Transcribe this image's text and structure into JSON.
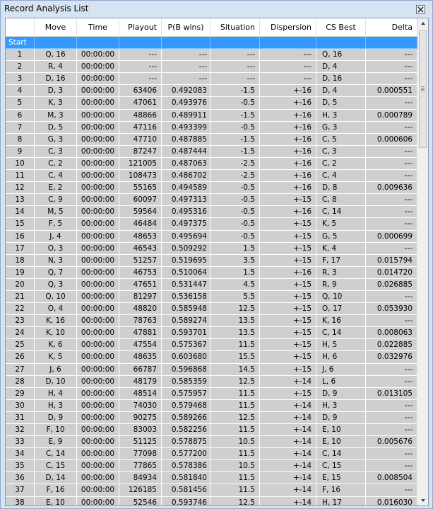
{
  "window": {
    "title": "Record Analysis List"
  },
  "columns": [
    "",
    "Move",
    "Time",
    "Playout",
    "P(B wins)",
    "Situation",
    "Dispersion",
    "CS Best",
    "Delta"
  ],
  "start_row": {
    "label": "Start"
  },
  "rows": [
    [
      "1",
      "Q, 16",
      "00:00:00",
      "---",
      "---",
      "---",
      "---",
      "Q, 16",
      "---"
    ],
    [
      "2",
      "R, 4",
      "00:00:00",
      "---",
      "---",
      "---",
      "---",
      "D, 4",
      "---"
    ],
    [
      "3",
      "D, 16",
      "00:00:00",
      "---",
      "---",
      "---",
      "---",
      "D, 16",
      "---"
    ],
    [
      "4",
      "D, 3",
      "00:00:00",
      "63406",
      "0.492083",
      "-1.5",
      "+-16",
      "D, 4",
      "0.000551"
    ],
    [
      "5",
      "K, 3",
      "00:00:00",
      "47061",
      "0.493976",
      "-0.5",
      "+-16",
      "D, 5",
      "---"
    ],
    [
      "6",
      "M, 3",
      "00:00:00",
      "48866",
      "0.489911",
      "-1.5",
      "+-16",
      "H, 3",
      "0.000789"
    ],
    [
      "7",
      "D, 5",
      "00:00:00",
      "47116",
      "0.493399",
      "-0.5",
      "+-16",
      "G, 3",
      "---"
    ],
    [
      "8",
      "G, 3",
      "00:00:00",
      "47710",
      "0.487885",
      "-1.5",
      "+-16",
      "C, 5",
      "0.000606"
    ],
    [
      "9",
      "C, 3",
      "00:00:00",
      "87247",
      "0.487444",
      "-1.5",
      "+-16",
      "C, 3",
      "---"
    ],
    [
      "10",
      "C, 2",
      "00:00:00",
      "121005",
      "0.487063",
      "-2.5",
      "+-16",
      "C, 2",
      "---"
    ],
    [
      "11",
      "C, 4",
      "00:00:00",
      "108473",
      "0.486702",
      "-2.5",
      "+-16",
      "C, 4",
      "---"
    ],
    [
      "12",
      "E, 2",
      "00:00:00",
      "55165",
      "0.494589",
      "-0.5",
      "+-16",
      "D, 8",
      "0.009636"
    ],
    [
      "13",
      "C, 9",
      "00:00:00",
      "60097",
      "0.497313",
      "-0.5",
      "+-15",
      "C, 8",
      "---"
    ],
    [
      "14",
      "M, 5",
      "00:00:00",
      "59564",
      "0.495316",
      "-0.5",
      "+-16",
      "C, 14",
      "---"
    ],
    [
      "15",
      "F, 5",
      "00:00:00",
      "46484",
      "0.497375",
      "-0.5",
      "+-15",
      "K, 5",
      "---"
    ],
    [
      "16",
      "J, 4",
      "00:00:00",
      "48653",
      "0.495694",
      "-0.5",
      "+-15",
      "G, 5",
      "0.000699"
    ],
    [
      "17",
      "O, 3",
      "00:00:00",
      "46543",
      "0.509292",
      "1.5",
      "+-15",
      "K, 4",
      "---"
    ],
    [
      "18",
      "N, 3",
      "00:00:00",
      "51257",
      "0.519695",
      "3.5",
      "+-15",
      "F, 17",
      "0.015794"
    ],
    [
      "19",
      "Q, 7",
      "00:00:00",
      "46753",
      "0.510064",
      "1.5",
      "+-16",
      "R, 3",
      "0.014720"
    ],
    [
      "20",
      "Q, 3",
      "00:00:00",
      "47651",
      "0.531447",
      "4.5",
      "+-15",
      "R, 9",
      "0.026885"
    ],
    [
      "21",
      "Q, 10",
      "00:00:00",
      "81297",
      "0.536158",
      "5.5",
      "+-15",
      "Q, 10",
      "---"
    ],
    [
      "22",
      "O, 4",
      "00:00:00",
      "48820",
      "0.585948",
      "12.5",
      "+-15",
      "O, 17",
      "0.053930"
    ],
    [
      "23",
      "K, 16",
      "00:00:00",
      "78763",
      "0.589274",
      "13.5",
      "+-15",
      "K, 16",
      "---"
    ],
    [
      "24",
      "K, 10",
      "00:00:00",
      "47881",
      "0.593701",
      "13.5",
      "+-15",
      "C, 14",
      "0.008063"
    ],
    [
      "25",
      "K, 6",
      "00:00:00",
      "47554",
      "0.575367",
      "11.5",
      "+-15",
      "H, 5",
      "0.022885"
    ],
    [
      "26",
      "K, 5",
      "00:00:00",
      "48635",
      "0.603680",
      "15.5",
      "+-15",
      "H, 6",
      "0.032976"
    ],
    [
      "27",
      "J, 6",
      "00:00:00",
      "66787",
      "0.596868",
      "14.5",
      "+-15",
      "J, 6",
      "---"
    ],
    [
      "28",
      "D, 10",
      "00:00:00",
      "48179",
      "0.585359",
      "12.5",
      "+-14",
      "L, 6",
      "---"
    ],
    [
      "29",
      "H, 4",
      "00:00:00",
      "48514",
      "0.575957",
      "11.5",
      "+-15",
      "D, 9",
      "0.013105"
    ],
    [
      "30",
      "H, 3",
      "00:00:00",
      "74030",
      "0.579468",
      "11.5",
      "+-14",
      "H, 3",
      "---"
    ],
    [
      "31",
      "D, 9",
      "00:00:00",
      "90275",
      "0.589266",
      "12.5",
      "+-14",
      "D, 9",
      "---"
    ],
    [
      "32",
      "F, 10",
      "00:00:00",
      "83003",
      "0.582256",
      "11.5",
      "+-14",
      "E, 10",
      "---"
    ],
    [
      "33",
      "E, 9",
      "00:00:00",
      "51125",
      "0.578875",
      "10.5",
      "+-14",
      "E, 10",
      "0.005676"
    ],
    [
      "34",
      "C, 14",
      "00:00:00",
      "77098",
      "0.577200",
      "11.5",
      "+-14",
      "C, 14",
      "---"
    ],
    [
      "35",
      "C, 15",
      "00:00:00",
      "77865",
      "0.578386",
      "10.5",
      "+-14",
      "C, 15",
      "---"
    ],
    [
      "36",
      "D, 14",
      "00:00:00",
      "84934",
      "0.581840",
      "11.5",
      "+-14",
      "E, 15",
      "0.008504"
    ],
    [
      "37",
      "F, 16",
      "00:00:00",
      "126185",
      "0.581456",
      "11.5",
      "+-14",
      "F, 16",
      "---"
    ],
    [
      "38",
      "E, 10",
      "00:00:00",
      "52546",
      "0.593746",
      "12.5",
      "+-14",
      "H, 17",
      "0.016030"
    ]
  ],
  "icons": {
    "close": "close-icon",
    "scroll_up": "arrow-up-icon",
    "scroll_down": "arrow-down-icon"
  },
  "colors": {
    "selection": "#3399ff",
    "row_bg": "#cfcfcf",
    "window_bg": "#d6e3f2"
  }
}
